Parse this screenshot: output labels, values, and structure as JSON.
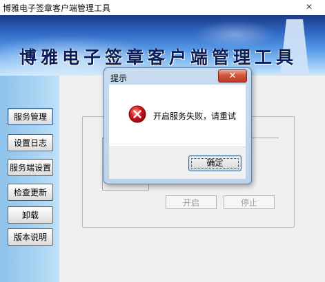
{
  "window": {
    "title": "博雅电子签章客户端管理工具",
    "close_glyph": "✕"
  },
  "banner": {
    "title": "博雅电子签章客户端管理工具"
  },
  "sidebar": {
    "items": [
      {
        "label": "服务管理",
        "active": true
      },
      {
        "label": "设置日志",
        "active": false
      },
      {
        "label": "服务端设置",
        "active": false
      },
      {
        "label": "检查更新",
        "active": false
      },
      {
        "label": "卸载",
        "active": false
      },
      {
        "label": "版本说明",
        "active": false
      }
    ]
  },
  "main": {
    "start_button": "开启",
    "stop_button": "停止"
  },
  "dialog": {
    "title": "提示",
    "close_glyph": "✕",
    "icon": "error-icon",
    "message": "开启服务失败，请重试",
    "ok_button": "确定"
  },
  "colors": {
    "error_red": "#d0161c",
    "sidebar_blue": "#a9d3f3",
    "banner_blue": "#2f67c4",
    "banner_text": "#0b1e57"
  }
}
